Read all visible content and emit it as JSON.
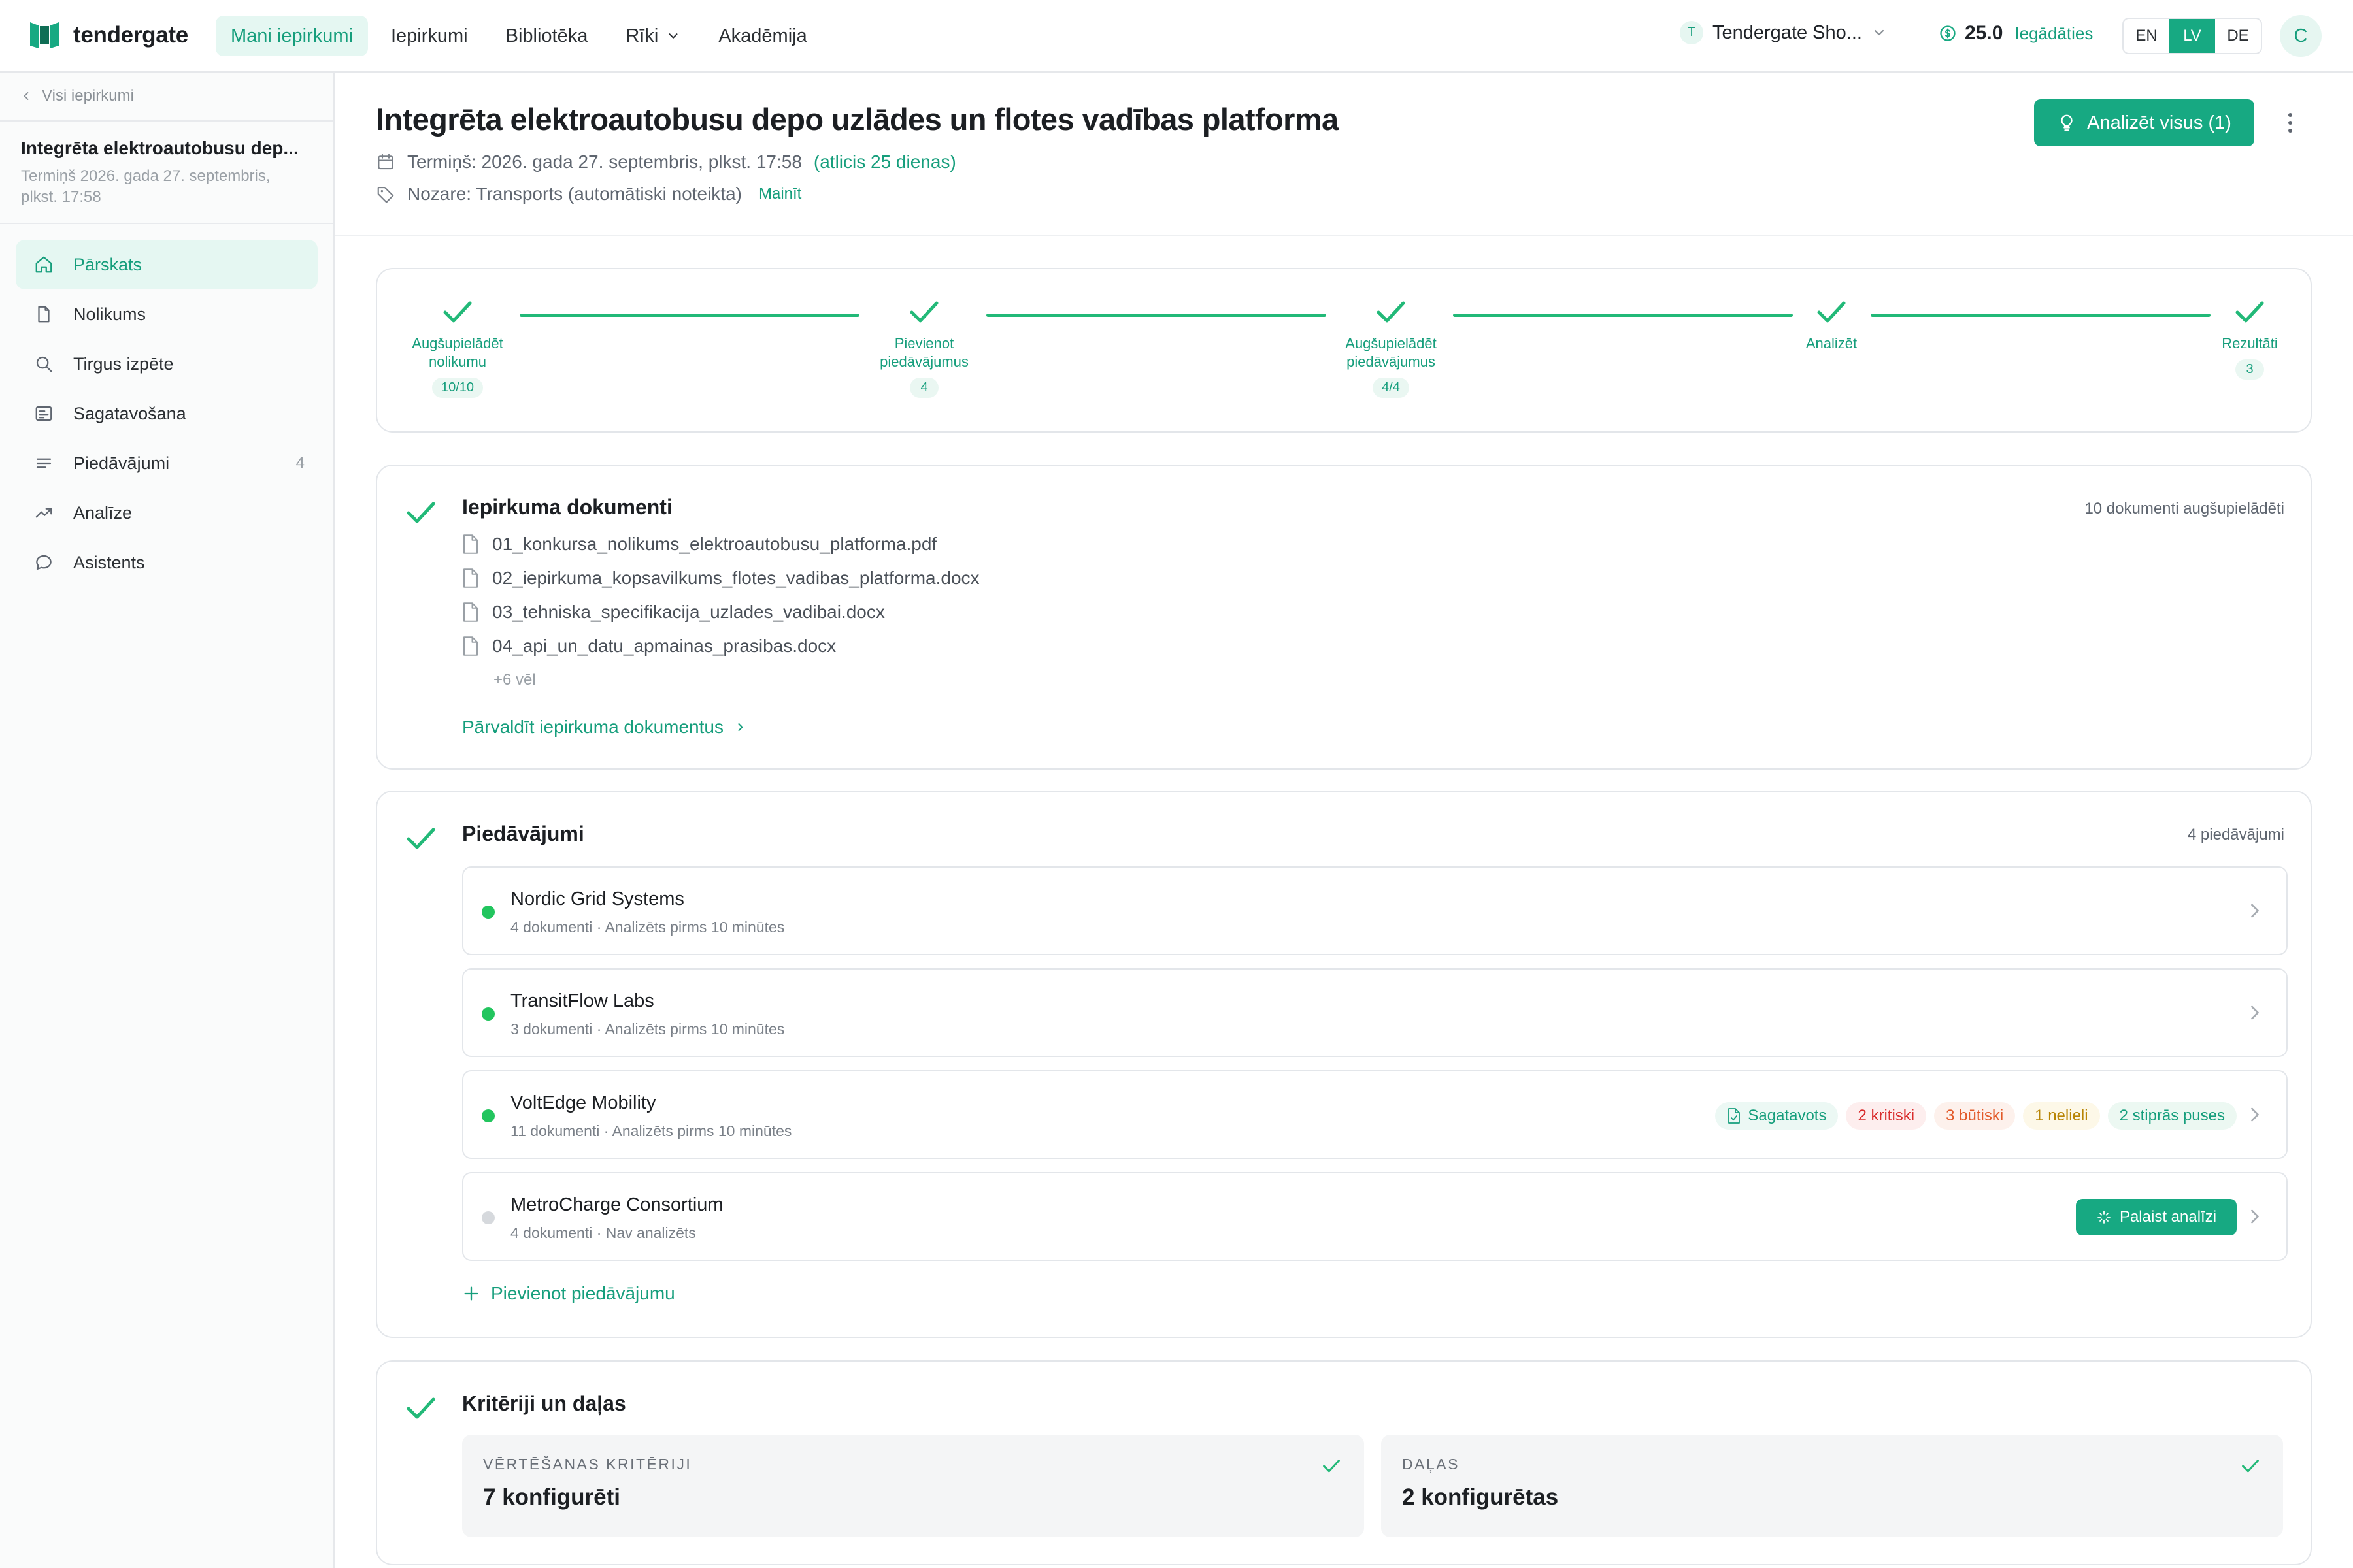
{
  "brand": {
    "name": "tendergate",
    "accent": "#17a982"
  },
  "nav": {
    "items": [
      {
        "label": "Mani iepirkumi"
      },
      {
        "label": "Iepirkumi"
      },
      {
        "label": "Bibliotēka"
      },
      {
        "label": "Rīki"
      },
      {
        "label": "Akadēmija"
      }
    ],
    "active_index": 0
  },
  "org": {
    "initial": "T",
    "name": "Tendergate Sho..."
  },
  "credits": {
    "value": "25.0",
    "link": "Iegādāties"
  },
  "languages": {
    "items": [
      "EN",
      "LV",
      "DE"
    ],
    "active": "LV"
  },
  "user": {
    "initial": "C"
  },
  "sidebar": {
    "back": "Visi iepirkumi",
    "title": "Integrēta elektroautobusu dep...",
    "subtitle": "Termiņš 2026. gada 27. septembris, plkst. 17:58",
    "items": [
      {
        "label": "Pārskats",
        "icon": "home-icon"
      },
      {
        "label": "Nolikums",
        "icon": "document-icon"
      },
      {
        "label": "Tirgus izpēte",
        "icon": "search-icon"
      },
      {
        "label": "Sagatavošana",
        "icon": "form-icon"
      },
      {
        "label": "Piedāvājumi",
        "icon": "list-icon",
        "count": "4"
      },
      {
        "label": "Analīze",
        "icon": "trending-icon"
      },
      {
        "label": "Asistents",
        "icon": "chat-icon"
      }
    ]
  },
  "header": {
    "title": "Integrēta elektroautobusu depo uzlādes un flotes vadības platforma",
    "deadline": "Termiņš: 2026. gada 27. septembris, plkst. 17:58",
    "deadline_left": "(atlicis 25 dienas)",
    "sector": "Nozare: Transports (automātiski noteikta)",
    "sector_change": "Mainīt",
    "analyze_all": "Analizēt visus (1)"
  },
  "stepper": {
    "steps": [
      {
        "label": "Augšupielādēt nolikumu",
        "line1": "Augšupielādēt",
        "line2": "nolikumu",
        "badge": "10/10"
      },
      {
        "label": "Pievienot piedāvājumus",
        "line1": "Pievienot",
        "line2": "piedāvājumus",
        "badge": "4"
      },
      {
        "label": "Augšupielādēt piedāvājumus",
        "line1": "Augšupielādēt",
        "line2": "piedāvājumus",
        "badge": "4/4"
      },
      {
        "label": "Analizēt",
        "line1": "Analizēt",
        "line2": "",
        "badge": ""
      },
      {
        "label": "Rezultāti",
        "line1": "Rezultāti",
        "line2": "",
        "badge": "3"
      }
    ]
  },
  "documents": {
    "title": "Iepirkuma dokumenti",
    "count_text": "10 dokumenti augšupielādēti",
    "files": [
      "01_konkursa_nolikums_elektroautobusu_platforma.pdf",
      "02_iepirkuma_kopsavilkums_flotes_vadibas_platforma.docx",
      "03_tehniska_specifikacija_uzlades_vadibai.docx",
      "04_api_un_datu_apmainas_prasibas.docx"
    ],
    "more": "+6 vēl",
    "manage": "Pārvaldīt iepirkuma dokumentus"
  },
  "bids": {
    "title": "Piedāvājumi",
    "count_text": "4 piedāvājumi",
    "items": [
      {
        "name": "Nordic Grid Systems",
        "sub": "4 dokumenti · Analizēts pirms 10 minūtes",
        "status": "analyzed"
      },
      {
        "name": "TransitFlow Labs",
        "sub": "3 dokumenti · Analizēts pirms 10 minūtes",
        "status": "analyzed"
      },
      {
        "name": "VoltEdge Mobility",
        "sub": "11 dokumenti · Analizēts pirms 10 minūtes",
        "status": "analyzed",
        "tags": {
          "prepared": "Sagatavots",
          "critical": "2 kritiski",
          "significant": "3 būtiski",
          "minor": "1 nelieli",
          "strengths": "2 stiprās puses"
        }
      },
      {
        "name": "MetroCharge Consortium",
        "sub": "4 dokumenti · Nav analizēts",
        "status": "not-analyzed",
        "action": "Palaist analīzi"
      }
    ],
    "add": "Pievienot piedāvājumu"
  },
  "criteria": {
    "title": "Kritēriji un daļas",
    "eval_label": "VĒRTĒŠANAS KRITĒRIJI",
    "eval_value": "7 konfigurēti",
    "parts_label": "DAĻAS",
    "parts_value": "2 konfigurētas"
  }
}
